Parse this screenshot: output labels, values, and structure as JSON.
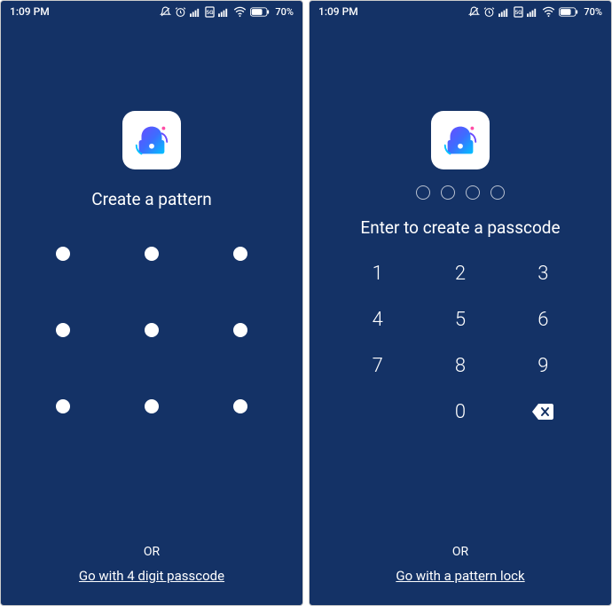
{
  "status": {
    "time": "1:09 PM",
    "battery": "70%"
  },
  "left": {
    "title": "Create a pattern",
    "or": "OR",
    "alt_link": "Go with 4 digit passcode"
  },
  "right": {
    "title": "Enter to create a passcode",
    "or": "OR",
    "alt_link": "Go with a pattern lock",
    "keys": {
      "k1": "1",
      "k2": "2",
      "k3": "3",
      "k4": "4",
      "k5": "5",
      "k6": "6",
      "k7": "7",
      "k8": "8",
      "k9": "9",
      "k0": "0"
    }
  }
}
